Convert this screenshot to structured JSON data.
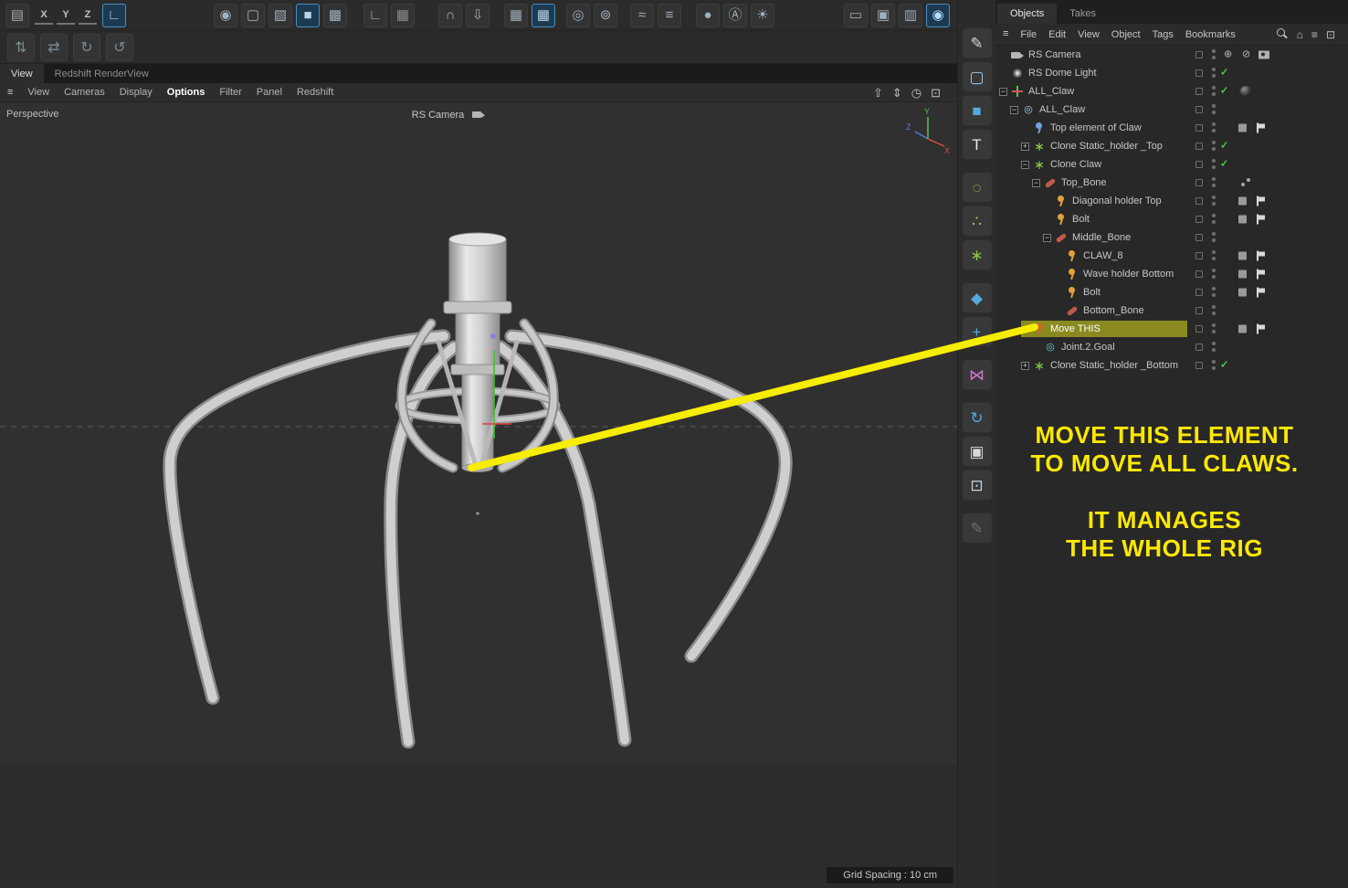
{
  "toolbar_main": {
    "groups": [
      {
        "icons": [
          {
            "name": "app-cube-icon"
          }
        ]
      },
      {
        "axis": [
          "X",
          "Y",
          "Z"
        ]
      },
      {
        "icons": [
          {
            "name": "coord-system-icon",
            "active": true
          }
        ]
      },
      {
        "icons": [
          {
            "name": "make-editable-icon"
          },
          {
            "name": "model-mode-icon"
          },
          {
            "name": "texture-mode-icon"
          },
          {
            "name": "object-mode-icon",
            "active": true
          },
          {
            "name": "animation-mode-icon"
          }
        ]
      },
      {
        "icons": [
          {
            "name": "workplane-icon"
          },
          {
            "name": "planar-workplane-icon"
          }
        ]
      },
      {
        "icons": [
          {
            "name": "enable-snap-icon"
          },
          {
            "name": "snap-settings-icon"
          }
        ]
      },
      {
        "icons": [
          {
            "name": "grid-icon"
          },
          {
            "name": "quantize-grid-icon",
            "active": true
          }
        ]
      },
      {
        "icons": [
          {
            "name": "enable-axis-icon"
          },
          {
            "name": "axis-settings-icon"
          }
        ]
      },
      {
        "icons": [
          {
            "name": "soft-selection-icon"
          },
          {
            "name": "soft-selection-settings-icon"
          }
        ]
      },
      {
        "icons": [
          {
            "name": "viewport-solo-icon"
          },
          {
            "name": "auto-keying-icon"
          },
          {
            "name": "measure-lamp-icon"
          }
        ]
      },
      {
        "align": "right",
        "icons": [
          {
            "name": "render-view-icon"
          },
          {
            "name": "render-to-pv-icon"
          },
          {
            "name": "render-settings-icon"
          },
          {
            "name": "redshift-render-icon",
            "active": true
          }
        ]
      }
    ]
  },
  "toolbar_secondary": {
    "icons": [
      {
        "name": "up-axis-icon"
      },
      {
        "name": "transfer-icon"
      },
      {
        "name": "loop-icon"
      },
      {
        "name": "box-loop-icon"
      }
    ]
  },
  "view_tabs": [
    {
      "label": "View",
      "active": true
    },
    {
      "label": "Redshift RenderView",
      "active": false
    }
  ],
  "viewport_menu": {
    "items": [
      {
        "label": "View"
      },
      {
        "label": "Cameras"
      },
      {
        "label": "Display"
      },
      {
        "label": "Options",
        "active": true
      },
      {
        "label": "Filter"
      },
      {
        "label": "Panel"
      },
      {
        "label": "Redshift"
      }
    ],
    "right_icons": [
      "hand-tool-icon",
      "dolly-icon",
      "history-icon",
      "maximize-view-icon"
    ]
  },
  "viewport": {
    "projection_label": "Perspective",
    "camera_label": "RS Camera",
    "grid_spacing_label": "Grid Spacing : 10 cm",
    "axis_gizmo": {
      "x": "X",
      "y": "Y",
      "z": "Z"
    }
  },
  "side_toolbar": {
    "icons": [
      "pen-tool-icon",
      "frame-region-icon",
      "cube-primitive-icon",
      "text-tool-icon",
      "dotted-circle-icon",
      "cluster-icon",
      "mograph-icon",
      "deformer-icon",
      "workplane-axis-icon",
      "mirror-icon",
      "rotate-circle-icon",
      "camera-tool-icon",
      "display-icon",
      "edit-pencil-icon"
    ]
  },
  "object_manager": {
    "tabs": [
      {
        "label": "Objects",
        "active": true
      },
      {
        "label": "Takes",
        "active": false
      }
    ],
    "menu_items": [
      "File",
      "Edit",
      "View",
      "Object",
      "Tags",
      "Bookmarks"
    ],
    "menu_icons": [
      "search-icon",
      "home-icon",
      "filter-icon",
      "external-link-icon"
    ],
    "rows": [
      {
        "label": "RS Camera",
        "indent": 0,
        "expander": "none",
        "icon": "camera",
        "right": [
          "slot",
          "dots",
          "target",
          "prohibit",
          "camera2"
        ]
      },
      {
        "label": "RS Dome Light",
        "indent": 0,
        "expander": "none",
        "icon": "domelight",
        "right": [
          "slot",
          "dots",
          "check"
        ]
      },
      {
        "label": "ALL_Claw",
        "indent": 0,
        "expander": "minus",
        "icon": "axis",
        "right": [
          "slot",
          "dots",
          "check",
          "sphere"
        ]
      },
      {
        "label": "ALL_Claw",
        "indent": 1,
        "expander": "minus",
        "icon": "nullobj",
        "right": [
          "slot",
          "dots"
        ]
      },
      {
        "label": "Top element of Claw",
        "indent": 2,
        "expander": "none",
        "icon": "jointblue",
        "right": [
          "slot",
          "dots",
          "layer",
          "flag"
        ]
      },
      {
        "label": "Clone Static_holder _Top",
        "indent": 2,
        "expander": "plus",
        "icon": "cloner",
        "right": [
          "slot",
          "dots",
          "check"
        ]
      },
      {
        "label": "Clone Claw",
        "indent": 2,
        "expander": "minus",
        "icon": "cloner",
        "right": [
          "slot",
          "dots",
          "check"
        ]
      },
      {
        "label": "Top_Bone",
        "indent": 3,
        "expander": "minus",
        "icon": "bone",
        "right": [
          "slot",
          "dots",
          "iktag"
        ]
      },
      {
        "label": "Diagonal  holder Top",
        "indent": 4,
        "expander": "none",
        "icon": "joint",
        "right": [
          "slot",
          "dots",
          "layer",
          "flag"
        ]
      },
      {
        "label": "Bolt",
        "indent": 4,
        "expander": "none",
        "icon": "joint",
        "right": [
          "slot",
          "dots",
          "layer",
          "flag"
        ]
      },
      {
        "label": "Middle_Bone",
        "indent": 4,
        "expander": "minus",
        "icon": "bone",
        "right": [
          "slot",
          "dots"
        ]
      },
      {
        "label": "CLAW_8",
        "indent": 5,
        "expander": "none",
        "icon": "joint",
        "right": [
          "slot",
          "dots",
          "layer",
          "flag"
        ]
      },
      {
        "label": "Wave holder Bottom",
        "indent": 5,
        "expander": "none",
        "icon": "joint",
        "right": [
          "slot",
          "dots",
          "layer",
          "flag"
        ]
      },
      {
        "label": "Bolt",
        "indent": 5,
        "expander": "none",
        "icon": "joint",
        "right": [
          "slot",
          "dots",
          "layer",
          "flag"
        ]
      },
      {
        "label": "Bottom_Bone",
        "indent": 5,
        "expander": "none",
        "icon": "bone",
        "right": [
          "slot",
          "dots"
        ]
      },
      {
        "label": "Move THIS",
        "indent": 2,
        "expander": "none",
        "icon": "jointred",
        "highlighted": true,
        "right": [
          "slot",
          "dots",
          "layer",
          "flag"
        ]
      },
      {
        "label": "Joint.2.Goal",
        "indent": 3,
        "expander": "none",
        "icon": "goal",
        "right": [
          "slot",
          "dots"
        ]
      },
      {
        "label": "Clone Static_holder _Bottom",
        "indent": 2,
        "expander": "plus",
        "icon": "cloner",
        "right": [
          "slot",
          "dots",
          "check"
        ]
      }
    ]
  },
  "annotation": {
    "lines": [
      "MOVE THIS ELEMENT",
      "TO MOVE ALL CLAWS.",
      "IT MANAGES",
      "THE WHOLE RIG"
    ],
    "color": "#ffe800"
  },
  "colors": {
    "highlight_row": "#8a8a20",
    "active_tool": "#4a8fc0",
    "check_green": "#46d146",
    "annotation_yellow": "#ffe800",
    "arrow_yellow": "#f6ed00"
  }
}
